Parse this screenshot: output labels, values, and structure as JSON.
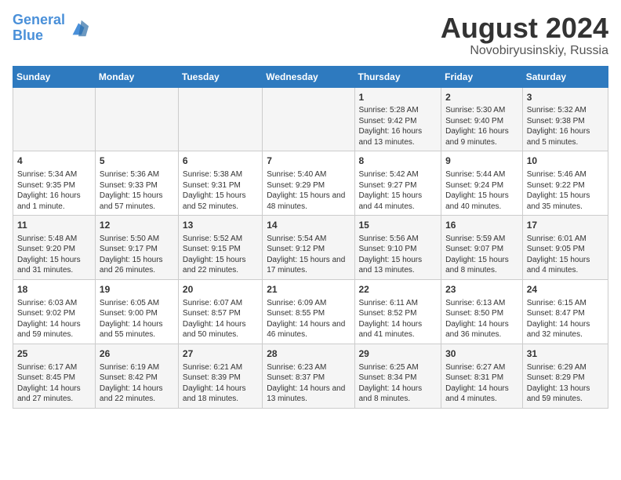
{
  "header": {
    "logo_line1": "General",
    "logo_line2": "Blue",
    "main_title": "August 2024",
    "subtitle": "Novobiryusinskiy, Russia"
  },
  "days_of_week": [
    "Sunday",
    "Monday",
    "Tuesday",
    "Wednesday",
    "Thursday",
    "Friday",
    "Saturday"
  ],
  "weeks": [
    [
      {
        "day": "",
        "info": ""
      },
      {
        "day": "",
        "info": ""
      },
      {
        "day": "",
        "info": ""
      },
      {
        "day": "",
        "info": ""
      },
      {
        "day": "1",
        "info": "Sunrise: 5:28 AM\nSunset: 9:42 PM\nDaylight: 16 hours and 13 minutes."
      },
      {
        "day": "2",
        "info": "Sunrise: 5:30 AM\nSunset: 9:40 PM\nDaylight: 16 hours and 9 minutes."
      },
      {
        "day": "3",
        "info": "Sunrise: 5:32 AM\nSunset: 9:38 PM\nDaylight: 16 hours and 5 minutes."
      }
    ],
    [
      {
        "day": "4",
        "info": "Sunrise: 5:34 AM\nSunset: 9:35 PM\nDaylight: 16 hours and 1 minute."
      },
      {
        "day": "5",
        "info": "Sunrise: 5:36 AM\nSunset: 9:33 PM\nDaylight: 15 hours and 57 minutes."
      },
      {
        "day": "6",
        "info": "Sunrise: 5:38 AM\nSunset: 9:31 PM\nDaylight: 15 hours and 52 minutes."
      },
      {
        "day": "7",
        "info": "Sunrise: 5:40 AM\nSunset: 9:29 PM\nDaylight: 15 hours and 48 minutes."
      },
      {
        "day": "8",
        "info": "Sunrise: 5:42 AM\nSunset: 9:27 PM\nDaylight: 15 hours and 44 minutes."
      },
      {
        "day": "9",
        "info": "Sunrise: 5:44 AM\nSunset: 9:24 PM\nDaylight: 15 hours and 40 minutes."
      },
      {
        "day": "10",
        "info": "Sunrise: 5:46 AM\nSunset: 9:22 PM\nDaylight: 15 hours and 35 minutes."
      }
    ],
    [
      {
        "day": "11",
        "info": "Sunrise: 5:48 AM\nSunset: 9:20 PM\nDaylight: 15 hours and 31 minutes."
      },
      {
        "day": "12",
        "info": "Sunrise: 5:50 AM\nSunset: 9:17 PM\nDaylight: 15 hours and 26 minutes."
      },
      {
        "day": "13",
        "info": "Sunrise: 5:52 AM\nSunset: 9:15 PM\nDaylight: 15 hours and 22 minutes."
      },
      {
        "day": "14",
        "info": "Sunrise: 5:54 AM\nSunset: 9:12 PM\nDaylight: 15 hours and 17 minutes."
      },
      {
        "day": "15",
        "info": "Sunrise: 5:56 AM\nSunset: 9:10 PM\nDaylight: 15 hours and 13 minutes."
      },
      {
        "day": "16",
        "info": "Sunrise: 5:59 AM\nSunset: 9:07 PM\nDaylight: 15 hours and 8 minutes."
      },
      {
        "day": "17",
        "info": "Sunrise: 6:01 AM\nSunset: 9:05 PM\nDaylight: 15 hours and 4 minutes."
      }
    ],
    [
      {
        "day": "18",
        "info": "Sunrise: 6:03 AM\nSunset: 9:02 PM\nDaylight: 14 hours and 59 minutes."
      },
      {
        "day": "19",
        "info": "Sunrise: 6:05 AM\nSunset: 9:00 PM\nDaylight: 14 hours and 55 minutes."
      },
      {
        "day": "20",
        "info": "Sunrise: 6:07 AM\nSunset: 8:57 PM\nDaylight: 14 hours and 50 minutes."
      },
      {
        "day": "21",
        "info": "Sunrise: 6:09 AM\nSunset: 8:55 PM\nDaylight: 14 hours and 46 minutes."
      },
      {
        "day": "22",
        "info": "Sunrise: 6:11 AM\nSunset: 8:52 PM\nDaylight: 14 hours and 41 minutes."
      },
      {
        "day": "23",
        "info": "Sunrise: 6:13 AM\nSunset: 8:50 PM\nDaylight: 14 hours and 36 minutes."
      },
      {
        "day": "24",
        "info": "Sunrise: 6:15 AM\nSunset: 8:47 PM\nDaylight: 14 hours and 32 minutes."
      }
    ],
    [
      {
        "day": "25",
        "info": "Sunrise: 6:17 AM\nSunset: 8:45 PM\nDaylight: 14 hours and 27 minutes."
      },
      {
        "day": "26",
        "info": "Sunrise: 6:19 AM\nSunset: 8:42 PM\nDaylight: 14 hours and 22 minutes."
      },
      {
        "day": "27",
        "info": "Sunrise: 6:21 AM\nSunset: 8:39 PM\nDaylight: 14 hours and 18 minutes."
      },
      {
        "day": "28",
        "info": "Sunrise: 6:23 AM\nSunset: 8:37 PM\nDaylight: 14 hours and 13 minutes."
      },
      {
        "day": "29",
        "info": "Sunrise: 6:25 AM\nSunset: 8:34 PM\nDaylight: 14 hours and 8 minutes."
      },
      {
        "day": "30",
        "info": "Sunrise: 6:27 AM\nSunset: 8:31 PM\nDaylight: 14 hours and 4 minutes."
      },
      {
        "day": "31",
        "info": "Sunrise: 6:29 AM\nSunset: 8:29 PM\nDaylight: 13 hours and 59 minutes."
      }
    ]
  ]
}
